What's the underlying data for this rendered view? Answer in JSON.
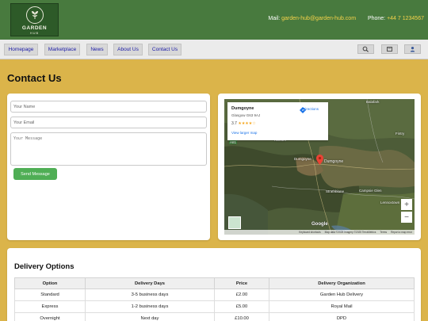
{
  "header": {
    "logo": {
      "title": "GARDEN",
      "subtitle": "HUB"
    },
    "mail_label": "Mail:",
    "mail_value": "garden-hub@garden-hub.com",
    "phone_label": "Phone:",
    "phone_value": "+44 7 1234567",
    "colors": {
      "background": "#487a3e",
      "accent": "#f5d24a"
    }
  },
  "nav": {
    "items": [
      {
        "label": "Homepage"
      },
      {
        "label": "Marketplace"
      },
      {
        "label": "News"
      },
      {
        "label": "About Us"
      },
      {
        "label": "Contact Us"
      }
    ],
    "icons": [
      "search-icon",
      "cart-icon",
      "user-icon"
    ]
  },
  "page": {
    "title": "Contact Us",
    "background": "#dbb44a"
  },
  "form": {
    "name_placeholder": "Your Name",
    "email_placeholder": "Your Email",
    "message_placeholder": "Your Message",
    "send_label": "Send Message",
    "send_color": "#4fae55"
  },
  "map": {
    "place_name": "Dumgoyne",
    "address": "Glasgow G63 9AJ",
    "rating": "3.7",
    "stars": "★★★★☆",
    "directions_label": "Directions",
    "larger_map_label": "View larger map",
    "marker_label": "Dumgoyne",
    "labels": {
      "balafark": "Balafark",
      "fintry": "Fintry",
      "killearn": "Killearn",
      "dumgoyne": "Dumgoyne",
      "strathblane": "Strathblane",
      "campsie_glen": "Campsie Glen",
      "lennoxtown": "Lennoxtown",
      "road_a81": "A81"
    },
    "google_label": "Google",
    "footer": {
      "shortcuts": "Keyboard shortcuts",
      "data": "Map data ©2025 Imagery ©2025 TerraMetrics",
      "terms": "Terms",
      "report": "Report a map error"
    }
  },
  "delivery": {
    "title": "Delivery Options",
    "columns": [
      "Option",
      "Delivery Days",
      "Price",
      "Delivery Organization"
    ],
    "rows": [
      {
        "option": "Standard",
        "days": "3-5 business days",
        "price": "£2.00",
        "org": "Garden Hub Delivery"
      },
      {
        "option": "Express",
        "days": "1-2 business days",
        "price": "£5.00",
        "org": "Royal Mail"
      },
      {
        "option": "Overnight",
        "days": "Next day",
        "price": "£10.00",
        "org": "DPD"
      }
    ]
  }
}
